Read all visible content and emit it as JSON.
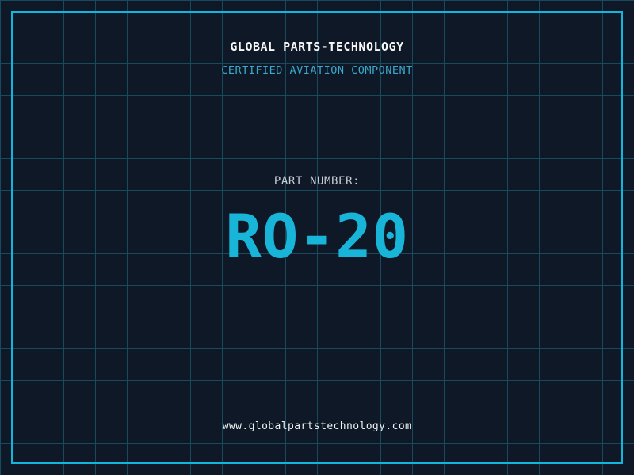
{
  "screen": {
    "background_color": "#0e1826",
    "grid_color": "#174a5e",
    "frame_color": "#12b6dd"
  },
  "header": {
    "brand": "GLOBAL PARTS-TECHNOLOGY",
    "subtitle": "CERTIFIED AVIATION COMPONENT",
    "subtitle_color": "#3aa8cc"
  },
  "part": {
    "label": "PART NUMBER:",
    "number": "RO-20",
    "number_color": "#18b5d9"
  },
  "footer": {
    "website": "www.globalpartstechnology.com"
  }
}
